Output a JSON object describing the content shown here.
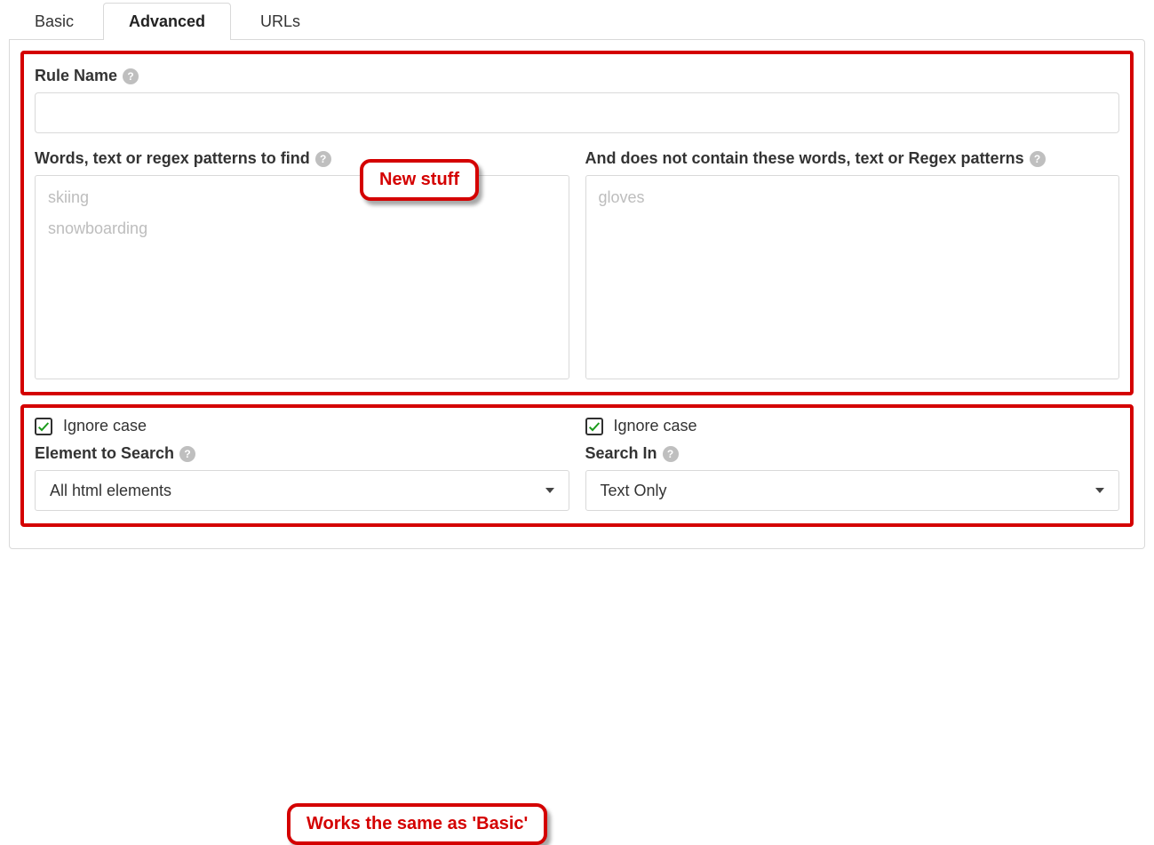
{
  "tabs": {
    "basic": "Basic",
    "advanced": "Advanced",
    "urls": "URLs"
  },
  "ruleName": {
    "label": "Rule Name",
    "value": ""
  },
  "find": {
    "label": "Words, text or regex patterns to find",
    "values": [
      "skiing",
      "snowboarding"
    ],
    "ignoreCaseLabel": "Ignore case",
    "ignoreCaseChecked": true,
    "elementLabel": "Element to Search",
    "elementValue": "All html elements"
  },
  "exclude": {
    "label": "And does not contain these words, text or Regex patterns",
    "values": [
      "gloves"
    ],
    "ignoreCaseLabel": "Ignore case",
    "ignoreCaseChecked": true,
    "searchInLabel": "Search In",
    "searchInValue": "Text Only"
  },
  "callouts": {
    "newStuff": "New stuff",
    "sameAsBasic": "Works the same as 'Basic'"
  }
}
